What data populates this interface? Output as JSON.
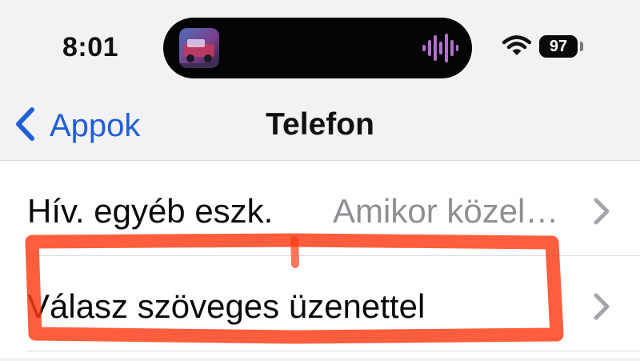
{
  "status_bar": {
    "time": "8:01",
    "battery_level": "97",
    "now_playing_art_icon": "album-art-icon",
    "waveform_icon": "audio-waveform-icon",
    "wifi_icon": "wifi-icon",
    "waveform_color": "#b36fd0"
  },
  "nav": {
    "back_label": "Appok",
    "back_icon": "chevron-left-icon",
    "title": "Telefon",
    "accent_color": "#1f5fd6"
  },
  "settings_rows": [
    {
      "label": "Hív. egyéb eszk.",
      "value": "Amikor közel…",
      "chevron_icon": "chevron-right-icon"
    },
    {
      "label": "Válasz szöveges üzenettel",
      "chevron_icon": "chevron-right-icon",
      "annotation": "highlighted-by-red-marker"
    }
  ],
  "annotation_color": "#ff3b14"
}
